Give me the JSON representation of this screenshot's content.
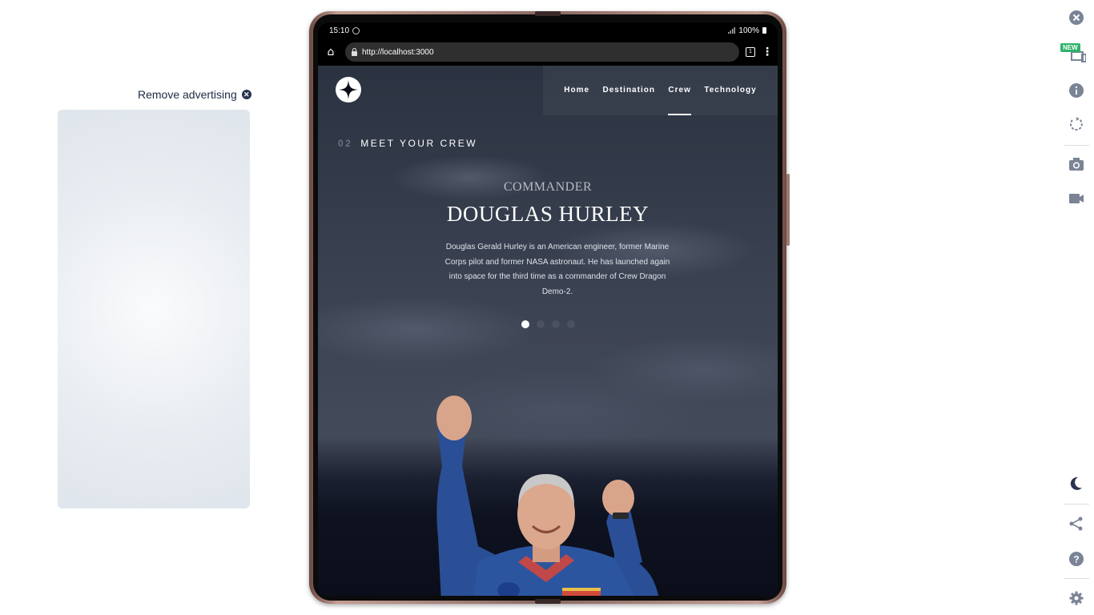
{
  "ad": {
    "remove_label": "Remove advertising"
  },
  "device": {
    "status_time": "15:10",
    "battery": "100%",
    "url": "http://localhost:3000",
    "tab_count": "1"
  },
  "site": {
    "nav": [
      {
        "label": "Home",
        "active": false
      },
      {
        "label": "Destination",
        "active": false
      },
      {
        "label": "Crew",
        "active": true
      },
      {
        "label": "Technology",
        "active": false
      }
    ],
    "section_number": "02",
    "section_title": "MEET YOUR CREW",
    "crew": {
      "role": "COMMANDER",
      "name": "DOUGLAS HURLEY",
      "bio": "Douglas Gerald Hurley is an American engineer, former Marine Corps pilot and former NASA astronaut. He has launched again into space for the third time as a commander of Crew Dragon Demo-2."
    },
    "slider": {
      "count": 4,
      "active_index": 0
    }
  },
  "sidebar_tools": [
    {
      "icon": "close-icon"
    },
    {
      "icon": "devices-icon",
      "badge": "NEW"
    },
    {
      "icon": "info-icon"
    },
    {
      "icon": "rotate-icon"
    },
    {
      "icon": "camera-icon"
    },
    {
      "icon": "video-icon"
    },
    {
      "icon": "moon-icon"
    },
    {
      "icon": "share-icon"
    },
    {
      "icon": "help-icon"
    },
    {
      "icon": "settings-icon"
    }
  ],
  "colors": {
    "sidebar_icon": "#7a8496",
    "badge_bg": "#2fb36b",
    "site_bg": "#0b0d17"
  }
}
